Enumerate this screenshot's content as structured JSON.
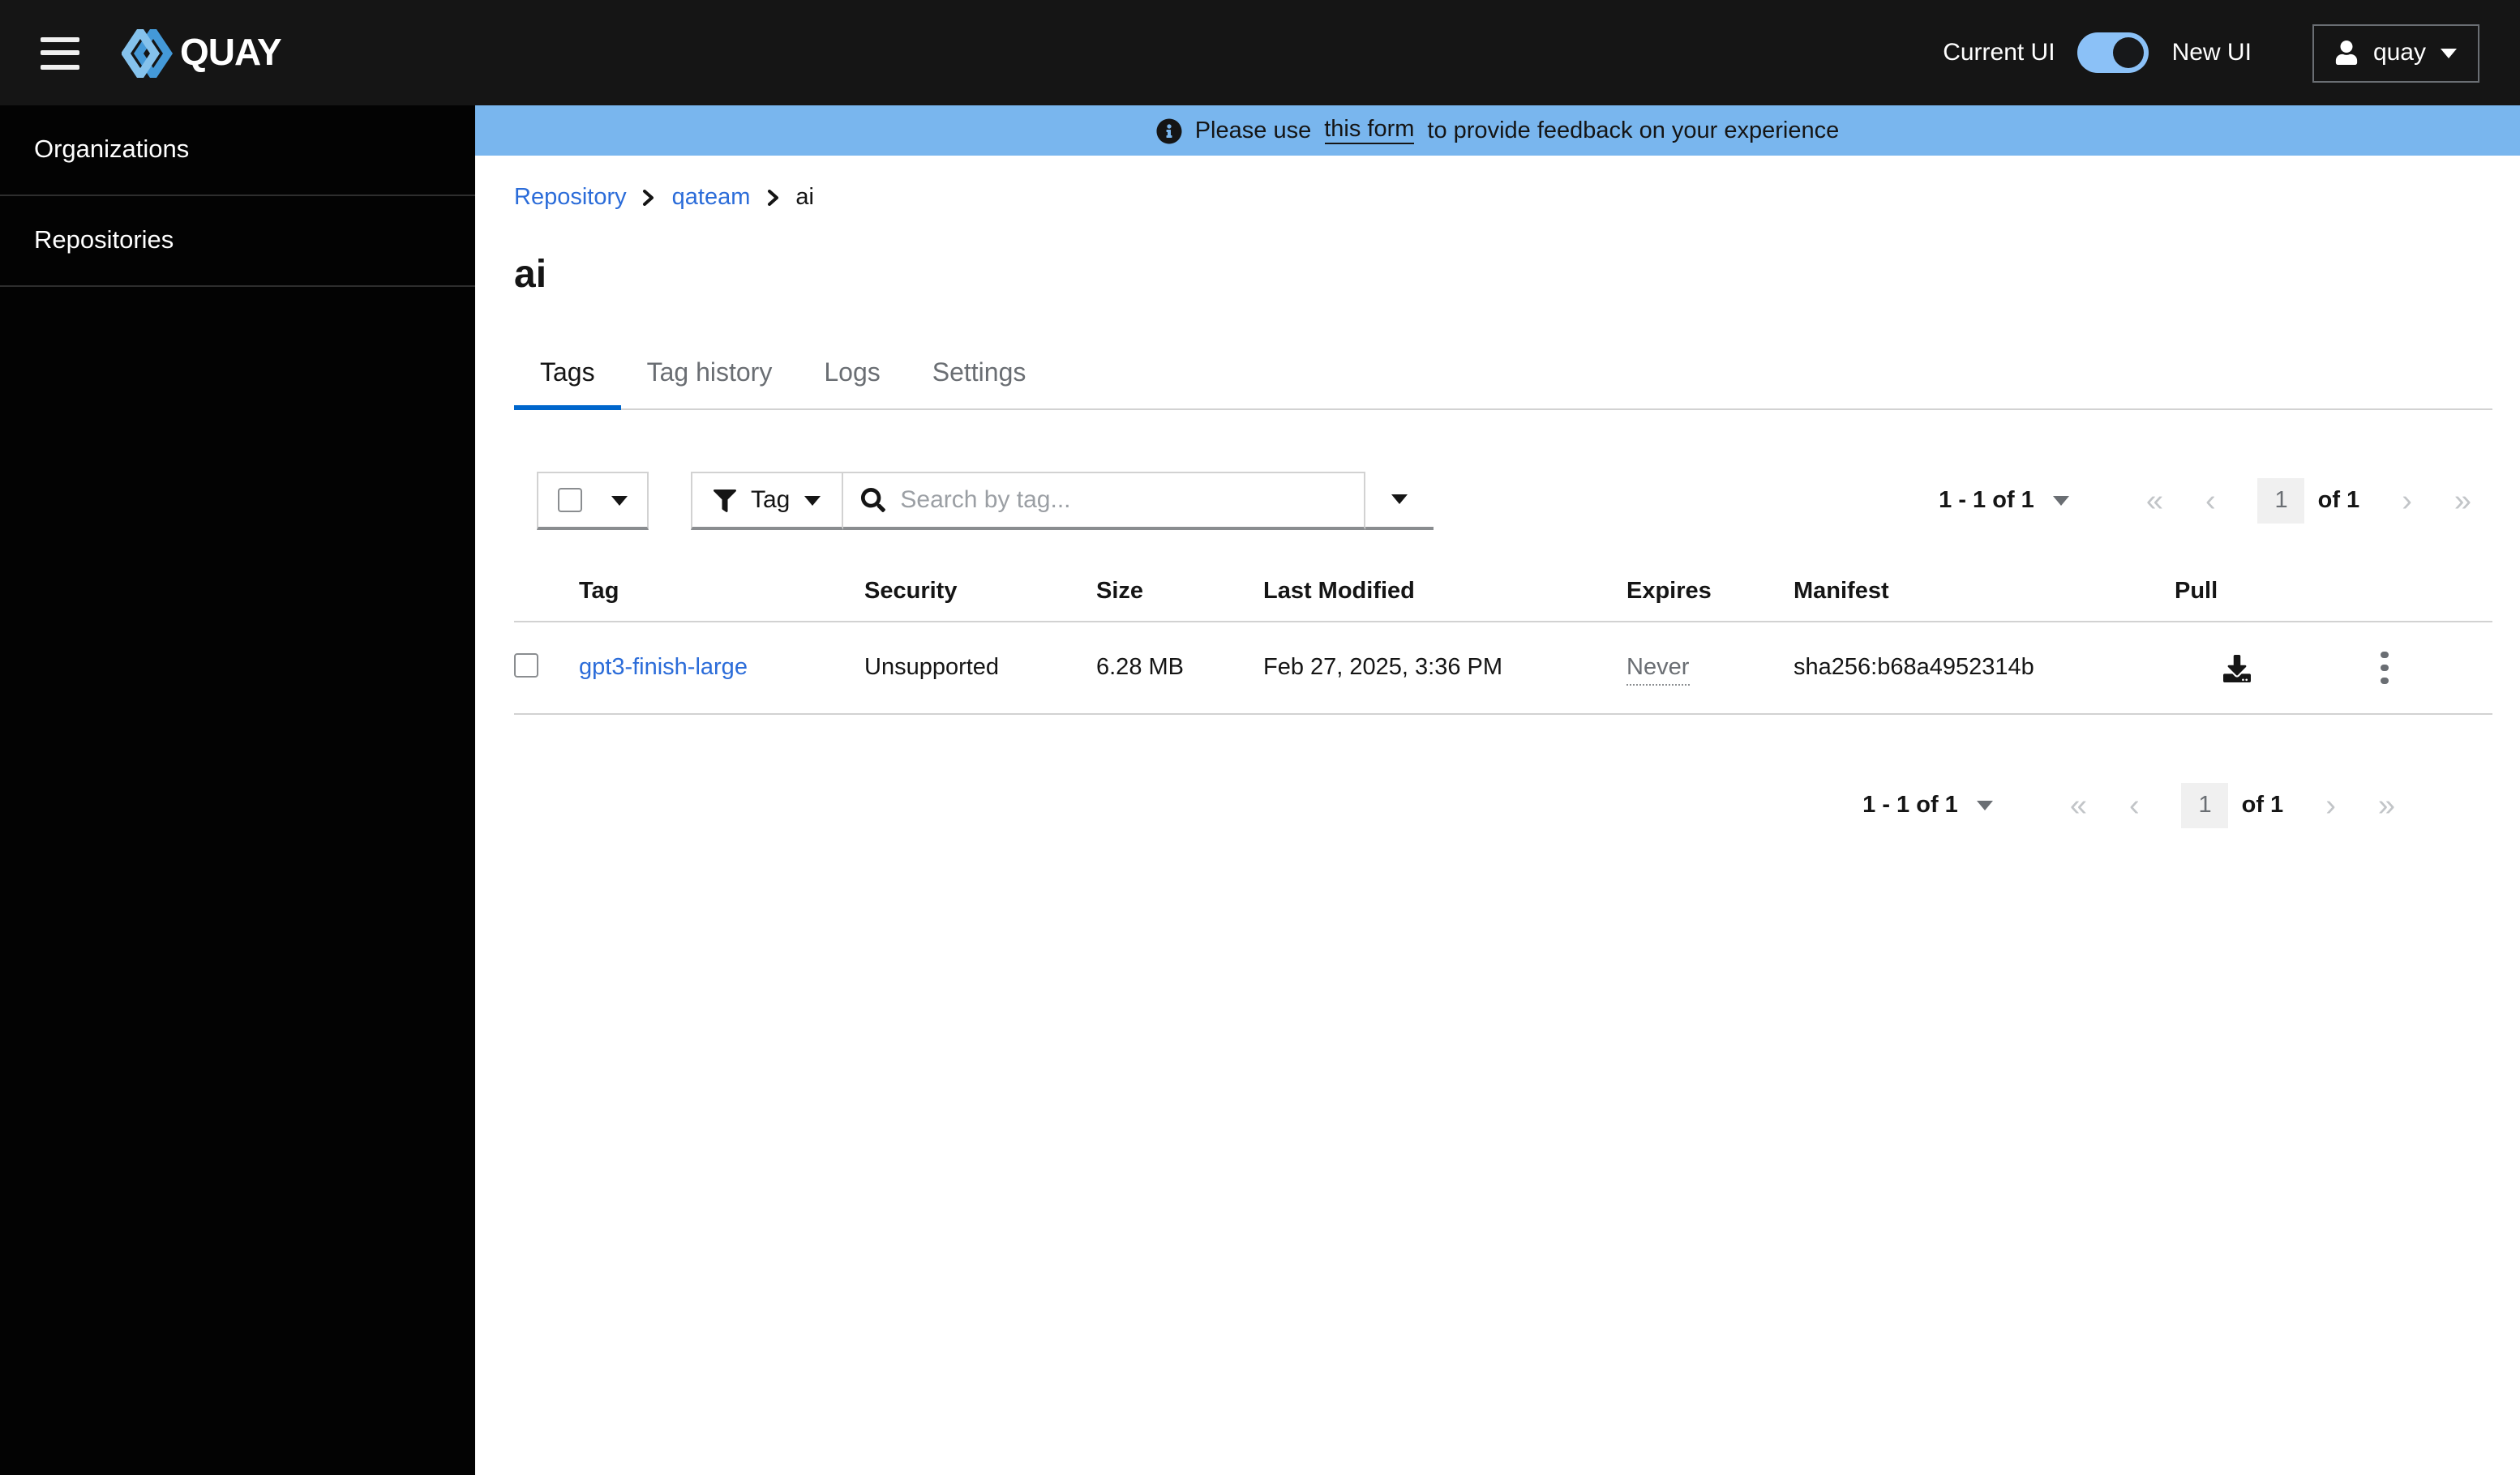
{
  "masthead": {
    "brand": "QUAY",
    "ui_toggle": {
      "left_label": "Current UI",
      "right_label": "New UI",
      "state": "on"
    },
    "user_menu": {
      "username": "quay"
    }
  },
  "sidebar": {
    "items": [
      {
        "label": "Organizations"
      },
      {
        "label": "Repositories"
      }
    ]
  },
  "banner": {
    "prefix": "Please use",
    "link_text": "this form",
    "suffix": "to provide feedback on your experience"
  },
  "breadcrumb": {
    "items": [
      {
        "label": "Repository"
      },
      {
        "label": "qateam"
      },
      {
        "label": "ai"
      }
    ]
  },
  "page": {
    "title": "ai"
  },
  "tabs": [
    {
      "label": "Tags",
      "active": true
    },
    {
      "label": "Tag history",
      "active": false
    },
    {
      "label": "Logs",
      "active": false
    },
    {
      "label": "Settings",
      "active": false
    }
  ],
  "toolbar": {
    "filter_label": "Tag",
    "search_placeholder": "Search by tag..."
  },
  "pagination": {
    "summary": "1 - 1 of 1",
    "current_page": "1",
    "of_label": "of 1"
  },
  "table": {
    "columns": [
      "Tag",
      "Security",
      "Size",
      "Last Modified",
      "Expires",
      "Manifest",
      "Pull"
    ],
    "rows": [
      {
        "tag": "gpt3-finish-large",
        "security": "Unsupported",
        "size": "6.28 MB",
        "last_modified": "Feb 27, 2025, 3:36 PM",
        "expires": "Never",
        "manifest": "sha256:b68a4952314b"
      }
    ]
  },
  "icons": [
    "menu-icon",
    "brand-logo-icon",
    "user-icon",
    "caret-down-icon",
    "info-icon",
    "filter-icon",
    "search-icon",
    "download-icon",
    "kebab-icon",
    "breadcrumb-chevron-icon",
    "pagination-first-icon",
    "pagination-prev-icon",
    "pagination-next-icon",
    "pagination-last-icon"
  ],
  "colors": {
    "masthead_bg": "#151515",
    "sidebar_bg": "#030303",
    "banner_bg": "#79b6ee",
    "link_blue": "#2b6cd9",
    "active_tab_underline": "#0066cc",
    "muted_text": "#6a6e73",
    "toggle_on": "#8bc1f7",
    "page_box_bg": "#f0f0f0"
  }
}
